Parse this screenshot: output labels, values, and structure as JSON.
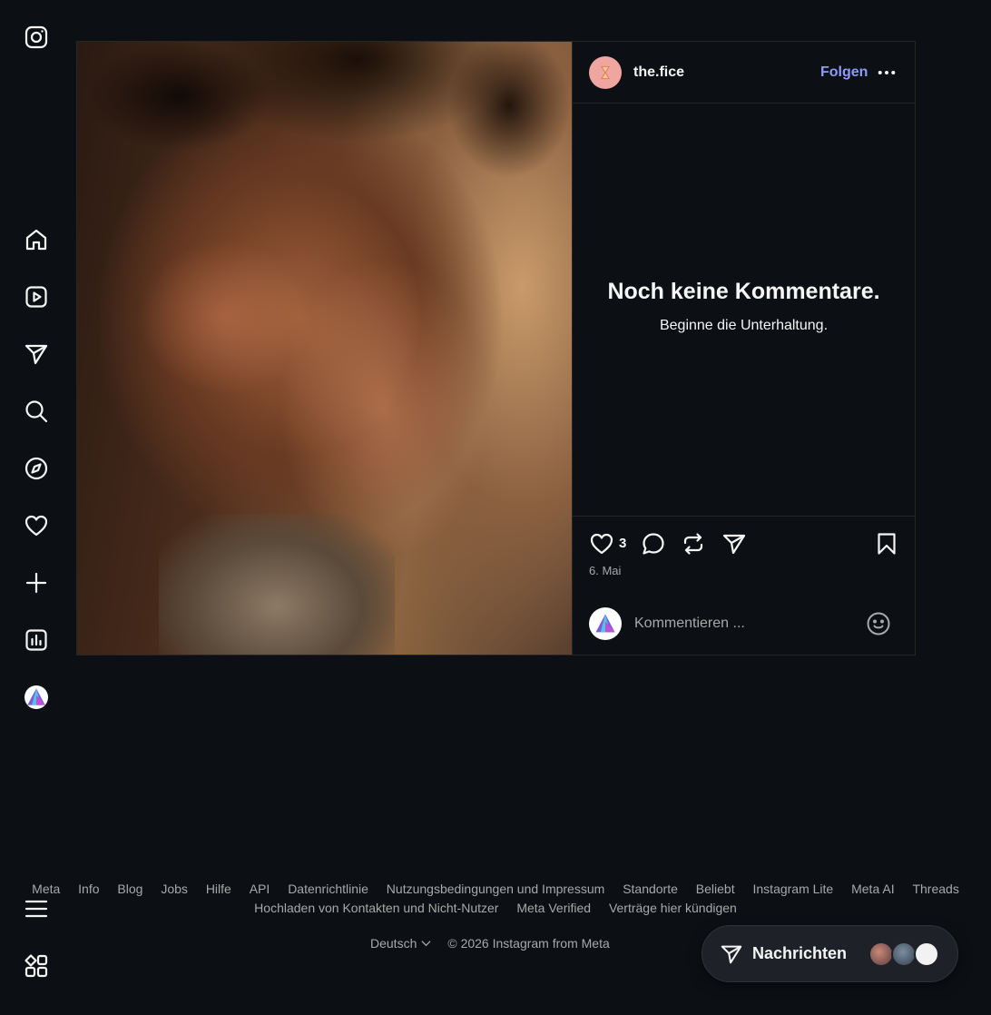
{
  "sidebar": {
    "items": [
      {
        "name": "instagram-logo-icon",
        "label": "Instagram"
      },
      {
        "name": "home-icon",
        "label": "Startseite"
      },
      {
        "name": "reels-icon",
        "label": "Reels"
      },
      {
        "name": "direct-icon",
        "label": "Nachrichten"
      },
      {
        "name": "search-icon",
        "label": "Suche"
      },
      {
        "name": "explore-icon",
        "label": "Entdecken"
      },
      {
        "name": "heart-icon",
        "label": "Benachrichtigungen"
      },
      {
        "name": "create-icon",
        "label": "Erstellen"
      },
      {
        "name": "dashboard-icon",
        "label": "Dashboard"
      },
      {
        "name": "profile-avatar",
        "label": "Profil"
      },
      {
        "name": "menu-icon",
        "label": "Mehr"
      },
      {
        "name": "apps-icon",
        "label": "Apps"
      }
    ]
  },
  "post": {
    "author": "the.fice",
    "follow_label": "Folgen",
    "empty_title": "Noch keine Kommentare.",
    "empty_subtitle": "Beginne die Unterhaltung.",
    "like_count": "3",
    "date": "6. Mai",
    "comment_placeholder": "Kommentieren ..."
  },
  "footer": {
    "row1": [
      "Meta",
      "Info",
      "Blog",
      "Jobs",
      "Hilfe",
      "API",
      "Datenrichtlinie",
      "Nutzungsbedingungen und Impressum",
      "Standorte",
      "Beliebt",
      "Instagram Lite",
      "Meta AI",
      "Threads"
    ],
    "row2": [
      "Hochladen von Kontakten und Nicht-Nutzer",
      "Meta Verified",
      "Verträge hier kündigen"
    ],
    "language": "Deutsch",
    "copyright": "© 2026 Instagram from Meta"
  },
  "messages": {
    "label": "Nachrichten"
  },
  "colors": {
    "background": "#0c1014",
    "accent": "#8c9bff",
    "muted": "#a8a8a8"
  }
}
